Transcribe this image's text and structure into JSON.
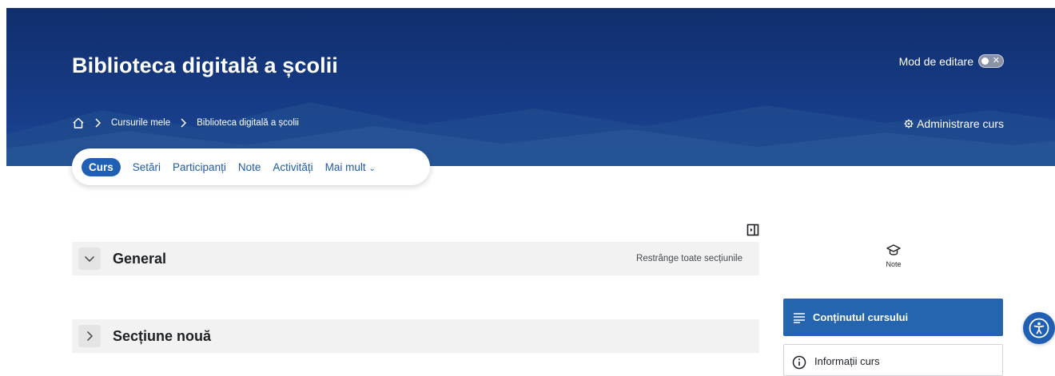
{
  "header": {
    "course_title": "Biblioteca digitală a școlii",
    "edit_mode_label": "Mod de editare",
    "edit_mode_enabled": false,
    "admin_label": "Administrare curs",
    "breadcrumb": [
      "Cursurile mele",
      "Biblioteca digitală a școlii"
    ]
  },
  "nav": {
    "tabs": [
      {
        "label": "Curs",
        "active": true
      },
      {
        "label": "Setări"
      },
      {
        "label": "Participanți"
      },
      {
        "label": "Note"
      },
      {
        "label": "Activități"
      },
      {
        "label": "Mai mult"
      }
    ]
  },
  "course": {
    "sections": [
      {
        "title": "General",
        "expanded": true
      },
      {
        "title": "Secțiune nouă",
        "expanded": false
      }
    ],
    "collapse_all_label": "Restrânge toate secțiunile"
  },
  "sidebar": {
    "note_label": "Note",
    "course_index_label": "Conținutul cursului",
    "info_label": "Informații curs"
  },
  "colors": {
    "header_bg": "#163a84",
    "accent": "#1f5fb4",
    "section_bg": "#f2f2f2"
  },
  "icons": [
    "home-icon",
    "chevron-right-icon",
    "gear-icon",
    "toggle-switch",
    "chevron-down-icon",
    "drawer-toggle-icon",
    "graduation-cap-icon",
    "list-icon",
    "info-icon",
    "accessibility-icon"
  ]
}
